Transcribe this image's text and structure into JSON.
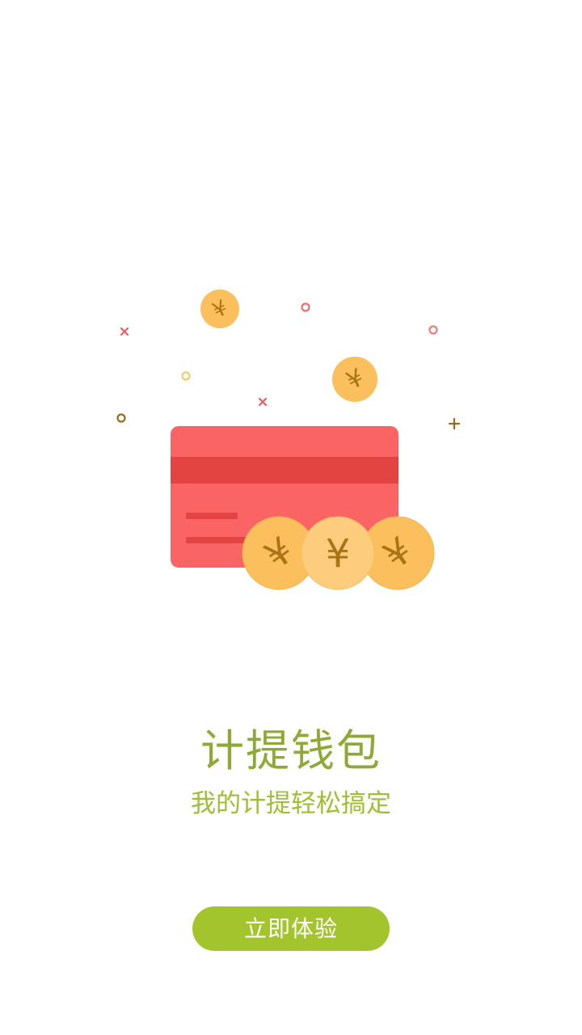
{
  "onboarding": {
    "title": "计提钱包",
    "subtitle": "我的计提轻松搞定",
    "cta_label": "立即体验"
  },
  "illustration": {
    "coin_symbol": "¥",
    "icons": [
      "wallet-card-icon",
      "yuan-coin-icon"
    ]
  },
  "colors": {
    "accent": "#a3c42d",
    "title": "#8ea936",
    "card": "#fb6464",
    "card_stripe": "#e34441",
    "coin": "#fcbf5e",
    "coin_light": "#fdcc7d",
    "coin_text": "#b07a18"
  }
}
